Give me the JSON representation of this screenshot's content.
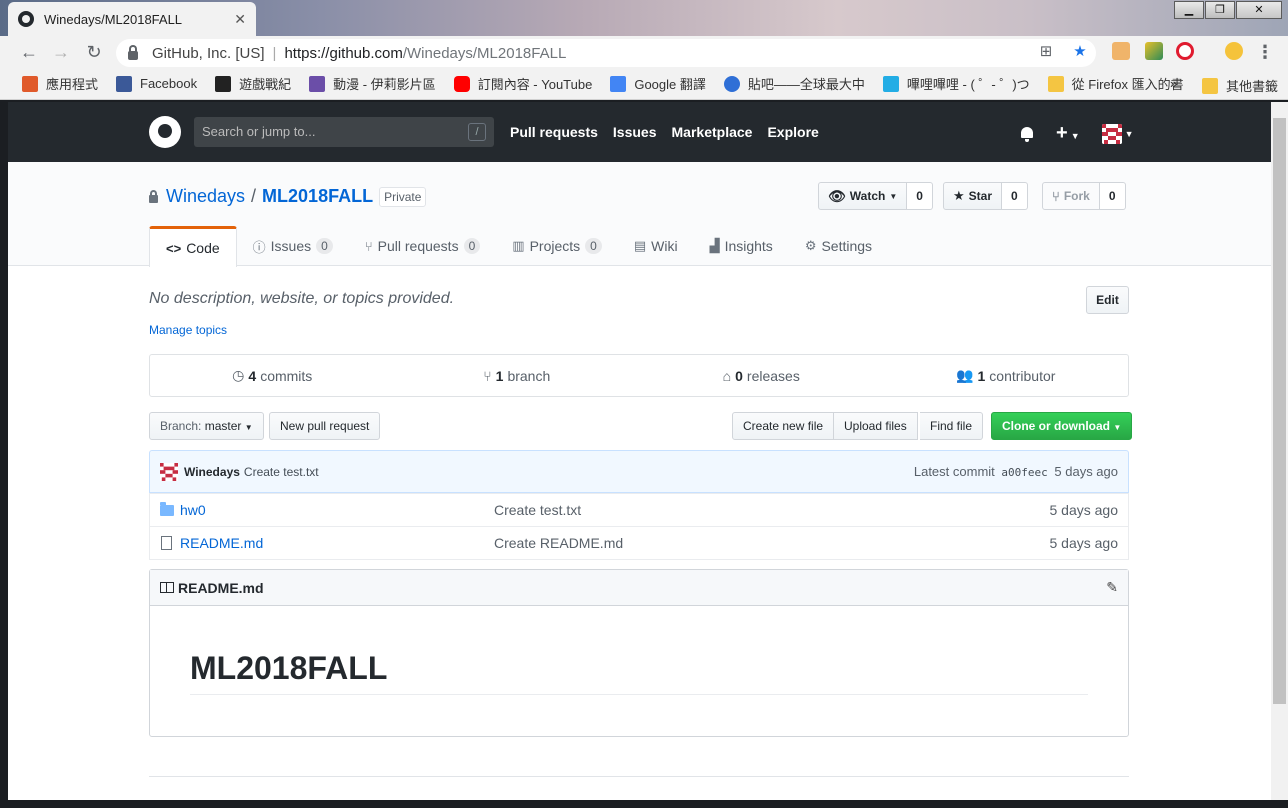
{
  "browser": {
    "tab_title": "Winedays/ML2018FALL",
    "tab_close": "✕",
    "window_buttons": [
      "▁",
      "❐",
      "✕"
    ],
    "site_org": "GitHub, Inc. [US]",
    "url_host": "https://github.com",
    "url_path": "/Winedays/ML2018FALL",
    "bookmarks": [
      {
        "label": "應用程式",
        "color": "#e05a2b"
      },
      {
        "label": "Facebook",
        "color": "#3b5998"
      },
      {
        "label": "遊戲戰紀",
        "color": "#222222"
      },
      {
        "label": "動漫 - 伊莉影片區",
        "color": "#6b4ea8"
      },
      {
        "label": "訂閱內容 - YouTube",
        "color": "#ff0000"
      },
      {
        "label": "Google 翻譯",
        "color": "#4285f4"
      },
      {
        "label": "貼吧——全球最大中",
        "color": "#2f6fd6"
      },
      {
        "label": "嗶哩嗶哩 - ( ゜- ゜)つ",
        "color": "#23ade5"
      },
      {
        "label": "從 Firefox 匯入的書",
        "color": "#f4c542"
      }
    ],
    "bookmarks_more": "»",
    "other_bookmarks": "其他書籤"
  },
  "github": {
    "search_placeholder": "Search or jump to...",
    "search_key": "/",
    "nav": [
      "Pull requests",
      "Issues",
      "Marketplace",
      "Explore"
    ],
    "plus": "+"
  },
  "repo": {
    "owner": "Winedays",
    "separator": "/",
    "name": "ML2018FALL",
    "visibility": "Private",
    "watch_label": "Watch",
    "watch_count": "0",
    "star_label": "Star",
    "star_count": "0",
    "fork_label": "Fork",
    "fork_count": "0",
    "tabs": [
      {
        "label": "Code",
        "icon": "<>",
        "count": ""
      },
      {
        "label": "Issues",
        "icon": "ⓘ",
        "count": "0"
      },
      {
        "label": "Pull requests",
        "icon": "⑂",
        "count": "0"
      },
      {
        "label": "Projects",
        "icon": "▥",
        "count": "0"
      },
      {
        "label": "Wiki",
        "icon": "▤",
        "count": ""
      },
      {
        "label": "Insights",
        "icon": "▟",
        "count": ""
      },
      {
        "label": "Settings",
        "icon": "⚙",
        "count": ""
      }
    ],
    "description": "No description, website, or topics provided.",
    "edit_label": "Edit",
    "manage_topics": "Manage topics",
    "summary": {
      "commits_count": "4",
      "commits_label": "commits",
      "branches_count": "1",
      "branches_label": "branch",
      "releases_count": "0",
      "releases_label": "releases",
      "contributors_count": "1",
      "contributors_label": "contributor"
    },
    "branch_prefix": "Branch:",
    "branch_name": "master",
    "new_pull_request": "New pull request",
    "create_new_file": "Create new file",
    "upload_files": "Upload files",
    "find_file": "Find file",
    "clone_or_download": "Clone or download",
    "latest_commit": {
      "author": "Winedays",
      "message": "Create test.txt",
      "label": "Latest commit",
      "sha": "a00feec",
      "age": "5 days ago"
    },
    "files": [
      {
        "name": "hw0",
        "type": "folder",
        "message": "Create test.txt",
        "age": "5 days ago"
      },
      {
        "name": "README.md",
        "type": "file",
        "message": "Create README.md",
        "age": "5 days ago"
      }
    ],
    "readme": {
      "filename": "README.md",
      "heading": "ML2018FALL"
    }
  }
}
